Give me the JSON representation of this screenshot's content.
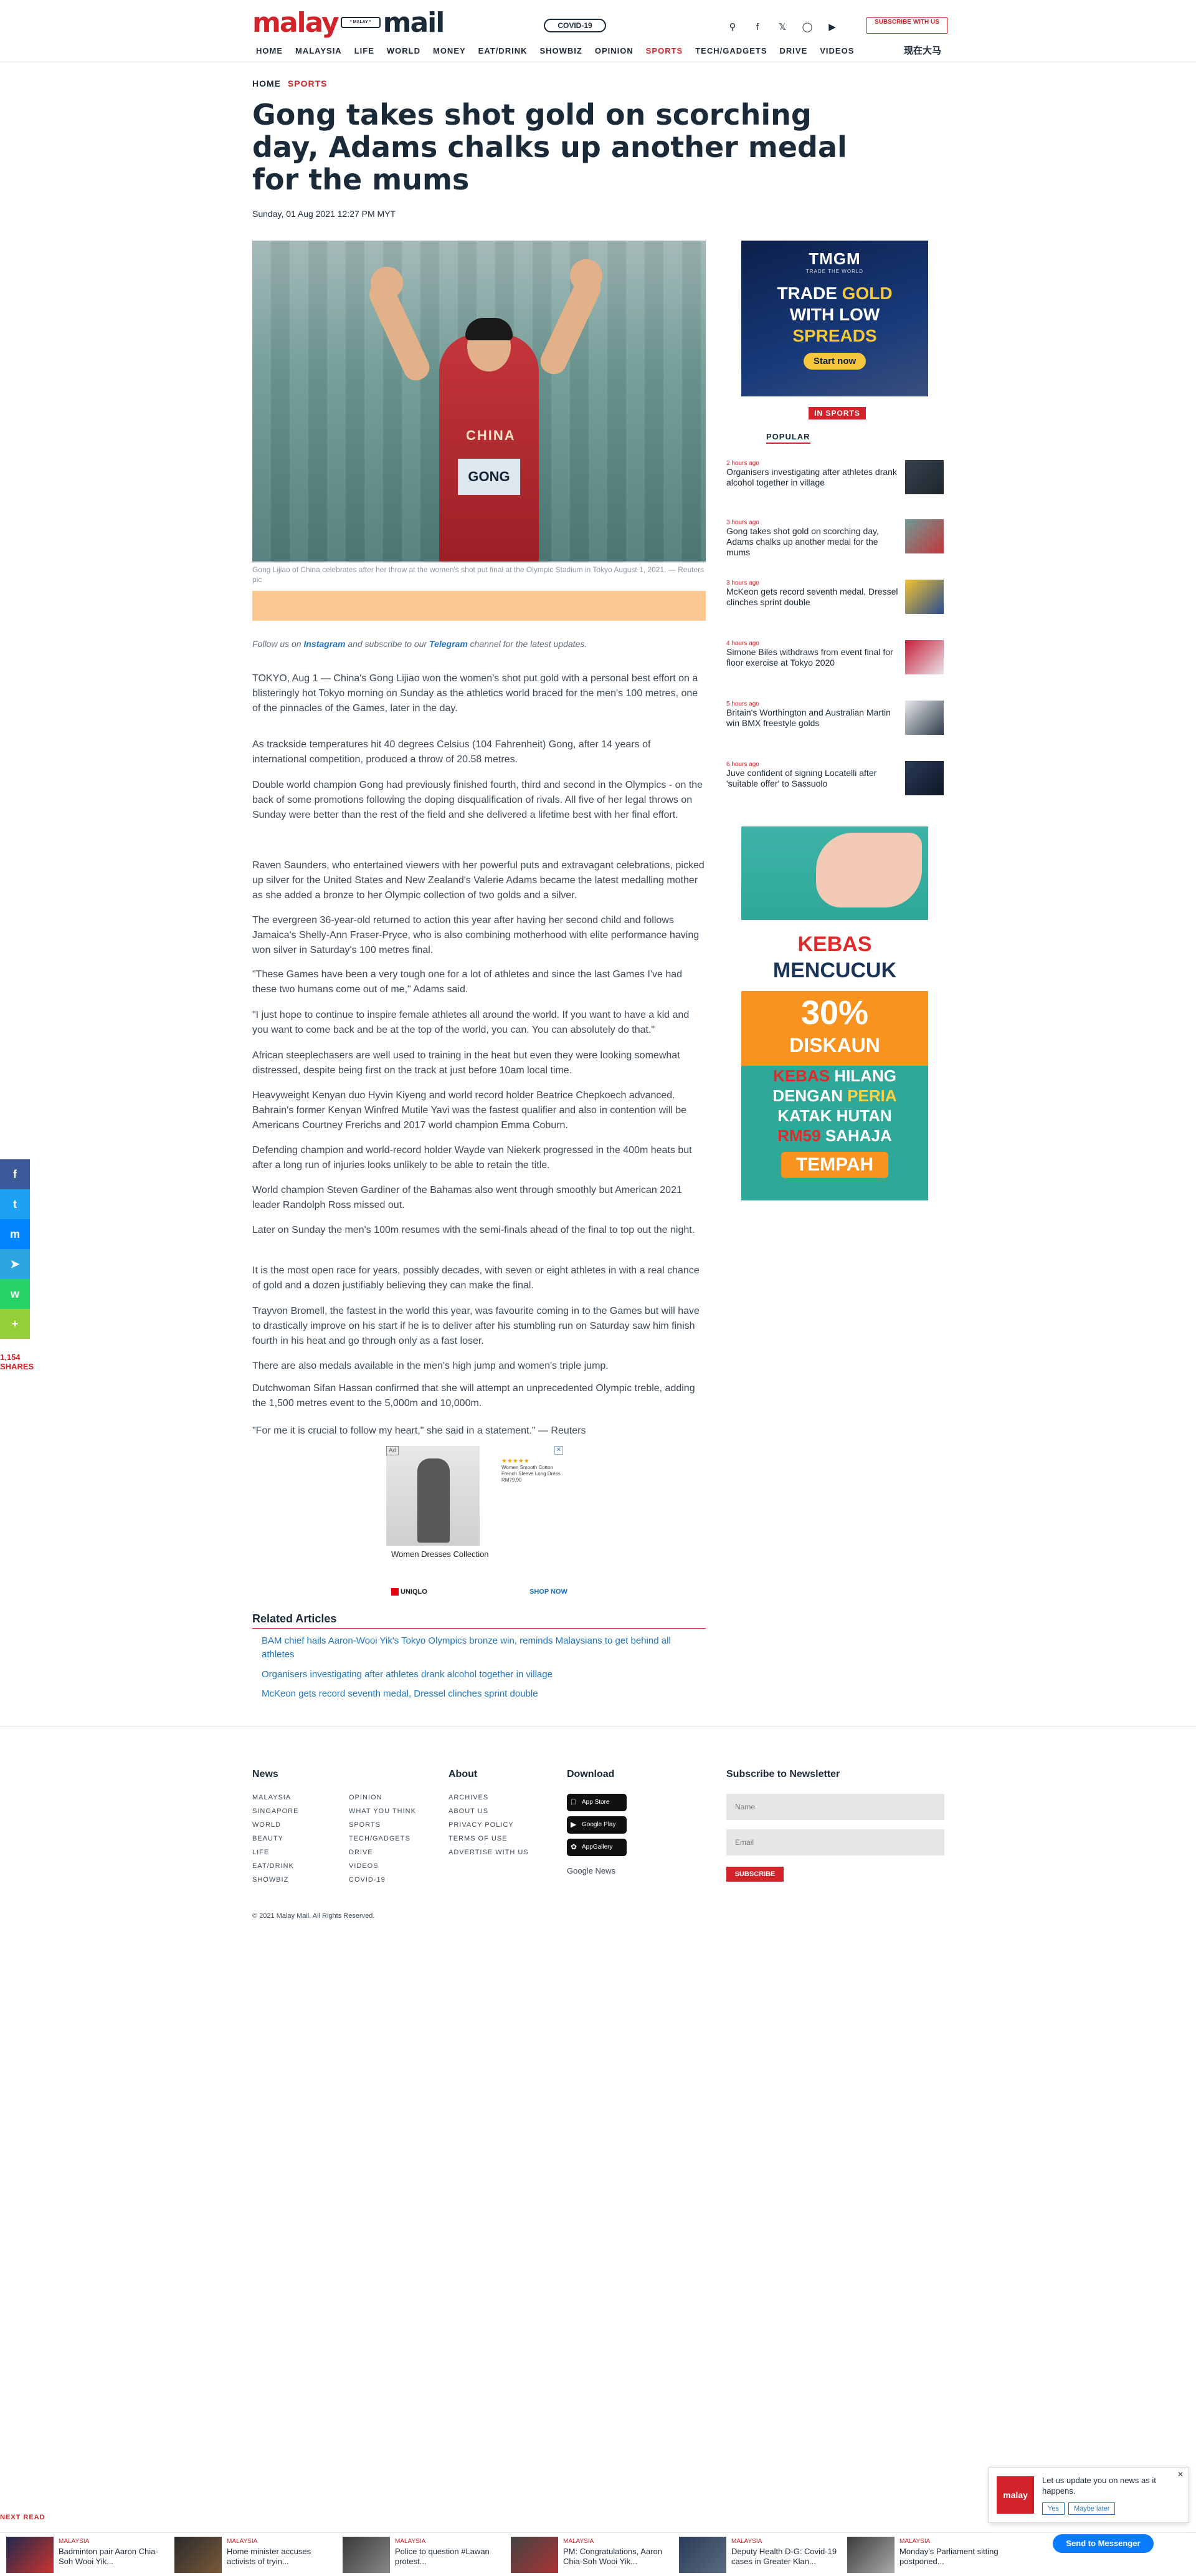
{
  "header": {
    "logo_part1": "malay",
    "logo_tag": "* MALAY *",
    "logo_part2": "mail",
    "covid_label": "COVID-19",
    "subscribe_label": "SUBSCRIBE WITH US",
    "icons": [
      "search-icon",
      "facebook-icon",
      "twitter-icon",
      "instagram-icon",
      "youtube-icon"
    ],
    "nav": [
      "HOME",
      "MALAYSIA",
      "LIFE",
      "WORLD",
      "MONEY",
      "EAT/DRINK",
      "SHOWBIZ",
      "OPINION",
      "SPORTS",
      "TECH/GADGETS",
      "DRIVE",
      "VIDEOS"
    ],
    "nav_chinese": "现在大马"
  },
  "article": {
    "breadcrumb": [
      "HOME",
      "SPORTS"
    ],
    "headline": "Gong takes shot gold on scorching day, Adams chalks up another medal for the mums",
    "date": "Sunday, 01 Aug 2021 12:27 PM MYT",
    "hero_shirt": "CHINA",
    "hero_bib": "GONG",
    "caption": "Gong Lijiao of China celebrates after her throw at the women's shot put final at the Olympic Stadium in Tokyo August 1, 2021. — Reuters pic",
    "follow_prefix": "Follow us on ",
    "follow_instagram": "Instagram",
    "follow_middle": " and subscribe to our ",
    "follow_telegram": "Telegram",
    "follow_suffix": " channel for the latest updates.",
    "paragraphs": [
      "TOKYO, Aug 1 — China's Gong Lijiao won the women's shot put gold with a personal best effort on a blisteringly hot Tokyo morning on Sunday as the athletics world braced for the men's 100 metres, one of the pinnacles of the Games, later in the day.",
      "As trackside temperatures hit 40 degrees Celsius (104 Fahrenheit) Gong, after 14 years of international competition, produced a throw of 20.58 metres.",
      "Double world champion Gong had previously finished fourth, third and second in the Olympics - on the back of some promotions following the doping disqualification of rivals. All five of her legal throws on Sunday were better than the rest of the field and she delivered a lifetime best with her final effort.",
      "Raven Saunders, who entertained viewers with her powerful puts and extravagant celebrations, picked up silver for the United States and New Zealand's Valerie Adams became the latest medalling mother as she added a bronze to her Olympic collection of two golds and a silver.",
      "The evergreen 36-year-old returned to action this year after having her second child and follows Jamaica's Shelly-Ann Fraser-Pryce, who is also combining motherhood with elite performance having won silver in Saturday's 100 metres final.",
      "\"These Games have been a very tough one for a lot of athletes and since the last Games I've had these two humans come out of me,\" Adams said.",
      "\"I just hope to continue to inspire female athletes all around the world. If you want to have a kid and you want to come back and be at the top of the world, you can. You can absolutely do that.\"",
      "African steeplechasers are well used to training in the heat but even they were looking somewhat distressed, despite being first on the track at just before 10am local time.",
      "Heavyweight Kenyan duo Hyvin Kiyeng and world record holder Beatrice Chepkoech advanced. Bahrain's former Kenyan Winfred Mutile Yavi was the fastest qualifier and also in contention will be Americans Courtney Frerichs and 2017 world champion Emma Coburn.",
      "Defending champion and world-record holder Wayde van Niekerk progressed in the 400m heats but after a long run of injuries looks unlikely to be able to retain the title.",
      "World champion Steven Gardiner of the Bahamas also went through smoothly but American 2021 leader Randolph Ross missed out.",
      "Later on Sunday the men's 100m resumes with the semi-finals ahead of the final to top out the night.",
      "It is the most open race for years, possibly decades, with seven or eight athletes in with a real chance of gold and a dozen justifiably believing they can make the final.",
      "Trayvon Bromell, the fastest in the world this year, was favourite coming in to the Games but will have to drastically improve on his start if he is to deliver after his stumbling run on Saturday saw him finish fourth in his heat and go through only as a fast loser.",
      "There are also medals available in the men's high jump and women's triple jump.",
      "Dutchwoman Sifan Hassan confirmed that she will attempt an unprecedented Olympic treble, adding the 1,500 metres event to the 5,000m and 10,000m.",
      "\"For me it is crucial to follow my heart,\" she said in a statement.\" — Reuters"
    ],
    "inline_ad": {
      "tag": "Ad",
      "title": "Women Dresses Collection",
      "brand": "UNIQLO",
      "cta": "SHOP NOW",
      "side_stars": "★★★★★",
      "side_text": "Women Smooth Cotton French Sleeve Long Dress RM79.90"
    },
    "related_title": "Related Articles",
    "related": [
      "BAM chief hails Aaron-Wooi Yik's Tokyo Olympics bronze win, reminds Malaysians to get behind all athletes",
      "Organisers investigating after athletes drank alcohol together in village",
      "McKeon gets record seventh medal, Dressel clinches sprint double"
    ]
  },
  "sidebar": {
    "ad1": {
      "brand": "TMGM",
      "tagline": "TRADE THE WORLD",
      "line1": "TRADE",
      "line1_gold": "GOLD",
      "line2": "WITH LOW",
      "line3_gold": "SPREADS",
      "cta": "Start now"
    },
    "in_sports": "IN SPORTS",
    "popular_tab": "POPULAR",
    "items": [
      {
        "meta": "2 hours ago",
        "title": "Organisers investigating after athletes drank alcohol together in village"
      },
      {
        "meta": "3 hours ago",
        "title": "Gong takes shot gold on scorching day, Adams chalks up another medal for the mums"
      },
      {
        "meta": "3 hours ago",
        "title": "McKeon gets record seventh medal, Dressel clinches sprint double"
      },
      {
        "meta": "4 hours ago",
        "title": "Simone Biles withdraws from event final for floor exercise at Tokyo 2020"
      },
      {
        "meta": "5 hours ago",
        "title": "Britain's Worthington and Australian Martin win BMX freestyle golds"
      },
      {
        "meta": "6 hours ago",
        "title": "Juve confident of signing Locatelli after 'suitable offer' to Sassuolo"
      }
    ],
    "ad2": {
      "kebas": "KEBAS",
      "mencucuk": "MENCUCUK",
      "percent": "30%",
      "diskaun": "DISKAUN",
      "l1a": "KEBAS",
      "l1b": " HILANG",
      "l2a": "DENGAN ",
      "l2b": "PERIA",
      "l3": "KATAK HUTAN",
      "l4a": "RM59",
      "l4b": " SAHAJA",
      "cta": "TEMPAH"
    }
  },
  "footer": {
    "news_title": "News",
    "news_links": [
      "MALAYSIA",
      "SINGAPORE",
      "WORLD",
      "BEAUTY",
      "LIFE",
      "EAT/DRINK",
      "SHOWBIZ",
      "OPINION",
      "WHAT YOU THINK",
      "SPORTS",
      "TECH/GADGETS",
      "DRIVE",
      "VIDEOS",
      "COVID-19"
    ],
    "about_title": "About",
    "about_links": [
      "ARCHIVES",
      "ABOUT US",
      "PRIVACY POLICY",
      "TERMS OF USE",
      "ADVERTISE WITH US"
    ],
    "download_title": "Download",
    "stores": [
      "App Store",
      "Google Play",
      "AppGallery"
    ],
    "gnews": "Google News",
    "newsletter_title": "Subscribe to Newsletter",
    "name_placeholder": "Name",
    "email_placeholder": "Email",
    "subscribe_btn": "SUBSCRIBE",
    "copyright": "© 2021 Malay Mail. All Rights Reserved."
  },
  "floating": {
    "share_icons": [
      "facebook-icon",
      "twitter-icon",
      "messenger-icon",
      "telegram-icon",
      "whatsapp-icon",
      "share-icon"
    ],
    "share_count": "1,154",
    "shares_label": "SHARES",
    "notify_logo": "malay",
    "notify_msg": "Let us update you on news as it happens.",
    "notify_yes": "Yes",
    "notify_no": "Maybe later",
    "messenger": "Send to Messenger",
    "next_read": "NEXT READ",
    "strip": [
      {
        "meta": "MALAYSIA",
        "title": "Badminton pair Aaron Chia-Soh Wooi Yik..."
      },
      {
        "meta": "MALAYSIA",
        "title": "Home minister accuses activists of tryin..."
      },
      {
        "meta": "MALAYSIA",
        "title": "Police to question #Lawan protest..."
      },
      {
        "meta": "MALAYSIA",
        "title": "PM: Congratulations, Aaron Chia-Soh Wooi Yik..."
      },
      {
        "meta": "MALAYSIA",
        "title": "Deputy Health D-G: Covid-19 cases in Greater Klan..."
      },
      {
        "meta": "MALAYSIA",
        "title": "Monday's Parliament sitting postponed..."
      }
    ]
  },
  "colors": {
    "brand_red": "#d2232a",
    "navy": "#1b2a38",
    "link_blue": "#1e73be"
  }
}
